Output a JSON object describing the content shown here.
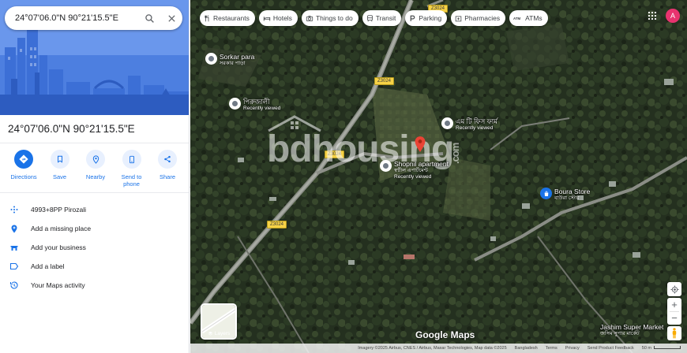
{
  "search": {
    "query": "24°07'06.0\"N 90°21'15.5\"E"
  },
  "place": {
    "title": "24°07'06.0\"N 90°21'15.5\"E"
  },
  "actions": [
    {
      "label": "Directions",
      "icon": "directions-icon"
    },
    {
      "label": "Save",
      "icon": "bookmark-icon"
    },
    {
      "label": "Nearby",
      "icon": "nearby-icon"
    },
    {
      "label": "Send to phone",
      "icon": "phone-icon"
    },
    {
      "label": "Share",
      "icon": "share-icon"
    }
  ],
  "info": [
    {
      "text": "4993+8PP Pirozali",
      "icon": "plus-code-icon"
    },
    {
      "text": "Add a missing place",
      "icon": "add-place-icon"
    },
    {
      "text": "Add your business",
      "icon": "business-icon"
    },
    {
      "text": "Add a label",
      "icon": "label-icon"
    },
    {
      "text": "Your Maps activity",
      "icon": "history-icon"
    }
  ],
  "chips": [
    {
      "label": "Restaurants",
      "icon": "restaurant-icon"
    },
    {
      "label": "Hotels",
      "icon": "hotel-icon"
    },
    {
      "label": "Things to do",
      "icon": "camera-icon"
    },
    {
      "label": "Transit",
      "icon": "transit-icon"
    },
    {
      "label": "Parking",
      "icon": "parking-icon"
    },
    {
      "label": "Pharmacies",
      "icon": "pharmacy-icon"
    },
    {
      "label": "ATMs",
      "icon": "atm-icon"
    }
  ],
  "account": {
    "initial": "A"
  },
  "roads": {
    "a": "Z3024",
    "b": "Z3024",
    "c": "Z3024",
    "d": "Z3024"
  },
  "pois": {
    "sorkar": {
      "name": "Sorkar para",
      "sub": "সরকার পাড়া"
    },
    "pirojali": {
      "name": "পিরুজালী",
      "sub": "Recently viewed"
    },
    "emti": {
      "name": "এম টি ফিস ফার্ম",
      "sub": "Recently viewed"
    },
    "shopnil": {
      "name": "Shopnil apartment",
      "sub": "স্বপ্নীল এপার্টমেন্ট",
      "sub2": "Recently viewed"
    },
    "boura": {
      "name": "Boura Store",
      "sub": "বাউরা স্টোর"
    },
    "jashim": {
      "name": "Jashim Super Market",
      "sub": "জসিম সুপার মার্কেট"
    }
  },
  "watermark": {
    "text": "bdhousing",
    "suffix": ".com"
  },
  "map": {
    "layers_label": "Layers",
    "logo": "Google Maps",
    "attribution": "Imagery ©2025 Airbus, CNES / Airbus, Maxar Technologies, Map data ©2025",
    "footer_links": [
      "Bangladesh",
      "Terms",
      "Privacy",
      "Send Product Feedback"
    ],
    "scale": "50 m"
  },
  "colors": {
    "accent": "#1a73e8",
    "avatar": "#e8336f",
    "road_label": "#f6d246"
  }
}
